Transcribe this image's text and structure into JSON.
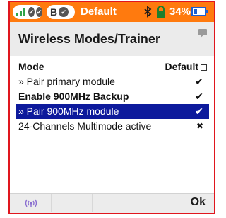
{
  "status_bar": {
    "title": "Default",
    "model_badge": "B",
    "battery": "34%",
    "icons": [
      "rssi-pill-icon",
      "bluetooth-icon",
      "lock-icon",
      "battery-icon"
    ]
  },
  "page": {
    "title": "Wireless Modes/Trainer"
  },
  "list": {
    "mode_label": "Mode",
    "mode_value": "Default",
    "rows": [
      {
        "label": "» Pair primary module",
        "mark": "✔"
      },
      {
        "label": "Enable 900MHz Backup",
        "mark": "✔"
      },
      {
        "label": "» Pair 900MHz module",
        "mark": "✔"
      },
      {
        "label": "24-Channels Multimode active",
        "mark": "✖"
      }
    ]
  },
  "bottom_bar": {
    "ok_label": "Ok"
  },
  "colors": {
    "accent": "#ff7a0e",
    "selection": "#0d1a9c",
    "frame": "#e0161e"
  }
}
